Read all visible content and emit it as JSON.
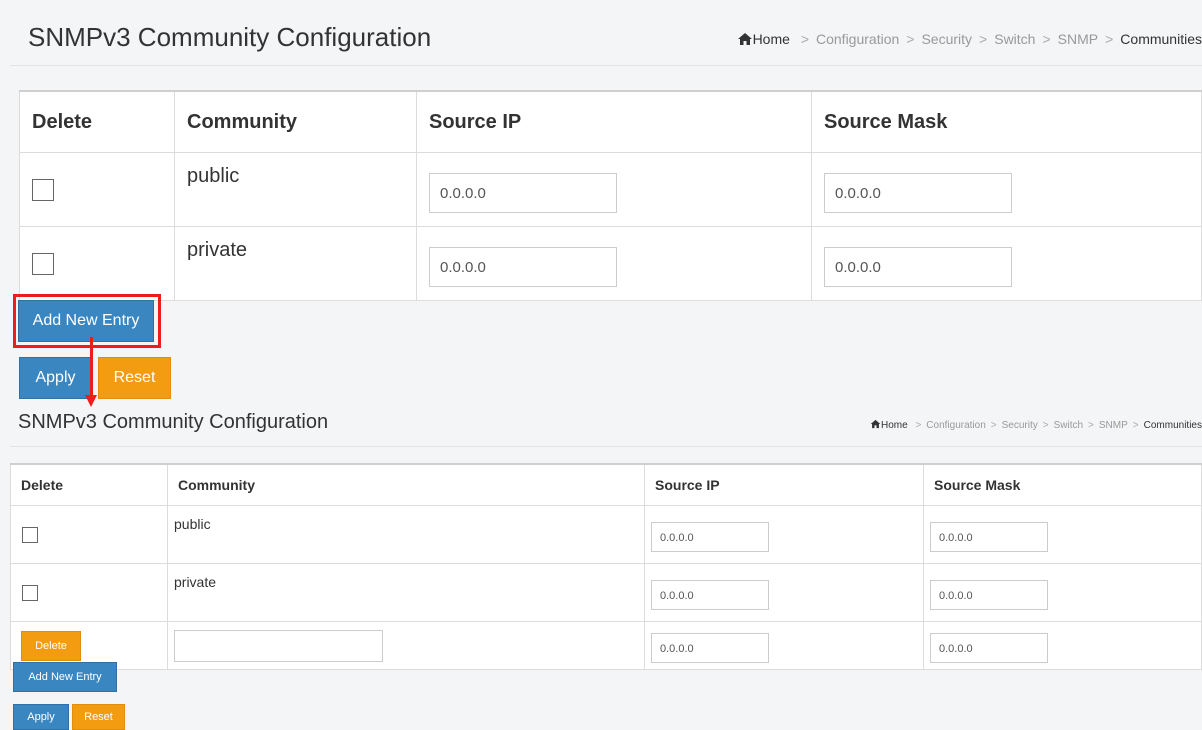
{
  "top": {
    "title": "SNMPv3 Community Configuration",
    "breadcrumb": [
      "Home",
      "Configuration",
      "Security",
      "Switch",
      "SNMP",
      "Communities"
    ],
    "columns": [
      "Delete",
      "Community",
      "Source IP",
      "Source Mask"
    ],
    "rows": [
      {
        "community": "public",
        "source_ip": "0.0.0.0",
        "source_mask": "0.0.0.0"
      },
      {
        "community": "private",
        "source_ip": "0.0.0.0",
        "source_mask": "0.0.0.0"
      }
    ],
    "add_new_entry": "Add New Entry",
    "apply": "Apply",
    "reset": "Reset"
  },
  "bottom": {
    "title": "SNMPv3 Community Configuration",
    "breadcrumb": [
      "Home",
      "Configuration",
      "Security",
      "Switch",
      "SNMP",
      "Communities"
    ],
    "columns": [
      "Delete",
      "Community",
      "Source IP",
      "Source Mask"
    ],
    "rows": [
      {
        "community": "public",
        "source_ip": "0.0.0.0",
        "source_mask": "0.0.0.0"
      },
      {
        "community": "private",
        "source_ip": "0.0.0.0",
        "source_mask": "0.0.0.0"
      }
    ],
    "new_row": {
      "delete_label": "Delete",
      "community": "",
      "source_ip": "0.0.0.0",
      "source_mask": "0.0.0.0"
    },
    "add_new_entry": "Add New Entry",
    "apply": "Apply",
    "reset": "Reset"
  },
  "colors": {
    "primary": "#3a86c0",
    "warning": "#f39c12",
    "highlight": "#ee1c1c"
  },
  "icons": {
    "home": "home-icon",
    "annotation": "red-arrow"
  }
}
